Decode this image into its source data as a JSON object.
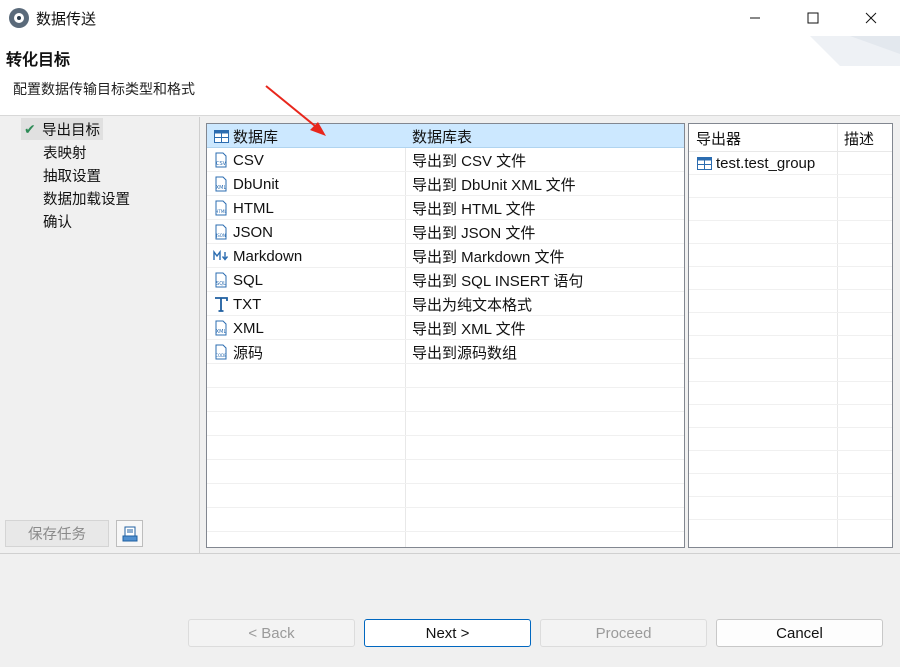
{
  "window": {
    "title": "数据传送",
    "minimize_icon": "minimize-icon",
    "maximize_icon": "maximize-icon",
    "close_icon": "close-icon"
  },
  "header": {
    "title": "转化目标",
    "description": "配置数据传输目标类型和格式"
  },
  "nav": {
    "items": [
      {
        "label": "导出目标",
        "active": true,
        "icon": "checkmark-icon"
      },
      {
        "label": "表映射"
      },
      {
        "label": "抽取设置"
      },
      {
        "label": "数据加载设置"
      },
      {
        "label": "确认"
      }
    ],
    "save_task_label": "保存任务",
    "save_icon": "save-task-icon"
  },
  "main_table": {
    "header": {
      "name": "数据库",
      "desc": "数据库表",
      "icon": "table-icon"
    },
    "rows": [
      {
        "name": "CSV",
        "desc": "导出到 CSV 文件",
        "icon": "csv-icon"
      },
      {
        "name": "DbUnit",
        "desc": "导出到 DbUnit XML 文件",
        "icon": "xml-icon"
      },
      {
        "name": "HTML",
        "desc": "导出到 HTML 文件",
        "icon": "html-icon"
      },
      {
        "name": "JSON",
        "desc": "导出到 JSON 文件",
        "icon": "json-icon"
      },
      {
        "name": "Markdown",
        "desc": "导出到 Markdown 文件",
        "icon": "markdown-icon"
      },
      {
        "name": "SQL",
        "desc": "导出到 SQL INSERT 语句",
        "icon": "sql-icon"
      },
      {
        "name": "TXT",
        "desc": "导出为纯文本格式",
        "icon": "txt-icon"
      },
      {
        "name": "XML",
        "desc": "导出到 XML 文件",
        "icon": "xml-icon"
      },
      {
        "name": "源码",
        "desc": "导出到源码数组",
        "icon": "code-icon"
      }
    ]
  },
  "side_table": {
    "headers": [
      "导出器",
      "描述"
    ],
    "rows": [
      {
        "name": "test.test_group",
        "icon": "table-icon"
      }
    ]
  },
  "buttons": {
    "back": "< Back",
    "next": "Next >",
    "proceed": "Proceed",
    "cancel": "Cancel"
  },
  "colors": {
    "selection": "#cce8ff",
    "accent_border": "#0067c0",
    "annotation_arrow": "#e8261c"
  }
}
